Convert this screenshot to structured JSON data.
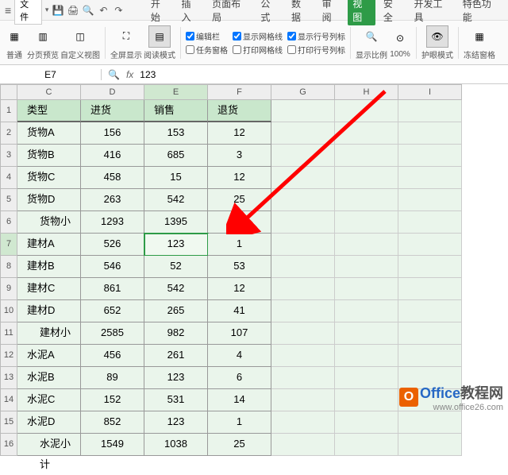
{
  "menubar": {
    "file_label": "文件",
    "tabs": [
      "开始",
      "插入",
      "页面布局",
      "公式",
      "数据",
      "审阅",
      "视图",
      "安全",
      "开发工具",
      "特色功能"
    ],
    "active_tab_index": 6
  },
  "ribbon": {
    "view_normal": "普通",
    "view_pagebreak": "分页预览",
    "view_custom": "自定义视图",
    "view_fullscreen": "全屏显示",
    "view_readmode": "阅读模式",
    "chk_formula_bar": "编辑栏",
    "chk_taskpane": "任务窗格",
    "chk_gridlines": "显示网格线",
    "chk_print_gridlines": "打印网格线",
    "chk_rowcol_hdr": "显示行号列标",
    "chk_print_rowcol": "打印行号列标",
    "zoom_ratio": "显示比例",
    "zoom_100": "100%",
    "eye_mode": "护眼模式",
    "freeze": "冻结窗格"
  },
  "formula_bar": {
    "name_box": "E7",
    "formula": "123"
  },
  "columns": [
    "C",
    "D",
    "E",
    "F",
    "G",
    "H",
    "I"
  ],
  "active_col_index": 2,
  "active_row_index": 7,
  "chart_data": {
    "type": "table",
    "headers": [
      "类型",
      "进货",
      "销售",
      "退货"
    ],
    "rows": [
      {
        "r": 1,
        "label": "类型",
        "vals": [
          "进货",
          "销售",
          "退货"
        ],
        "is_header": true
      },
      {
        "r": 2,
        "label": "货物A",
        "vals": [
          156,
          153,
          12
        ]
      },
      {
        "r": 3,
        "label": "货物B",
        "vals": [
          416,
          685,
          3
        ]
      },
      {
        "r": 4,
        "label": "货物C",
        "vals": [
          458,
          15,
          12
        ]
      },
      {
        "r": 5,
        "label": "货物D",
        "vals": [
          263,
          542,
          25
        ]
      },
      {
        "r": 6,
        "label": "货物小计",
        "vals": [
          1293,
          1395,
          52
        ],
        "subtotal": true
      },
      {
        "r": 7,
        "label": "建材A",
        "vals": [
          526,
          123,
          1
        ]
      },
      {
        "r": 8,
        "label": "建材B",
        "vals": [
          546,
          52,
          53
        ]
      },
      {
        "r": 9,
        "label": "建材C",
        "vals": [
          861,
          542,
          12
        ]
      },
      {
        "r": 10,
        "label": "建材D",
        "vals": [
          652,
          265,
          41
        ]
      },
      {
        "r": 11,
        "label": "建材小计",
        "vals": [
          2585,
          982,
          107
        ],
        "subtotal": true
      },
      {
        "r": 12,
        "label": "水泥A",
        "vals": [
          456,
          261,
          4
        ]
      },
      {
        "r": 13,
        "label": "水泥B",
        "vals": [
          89,
          123,
          6
        ]
      },
      {
        "r": 14,
        "label": "水泥C",
        "vals": [
          152,
          531,
          14
        ]
      },
      {
        "r": 15,
        "label": "水泥D",
        "vals": [
          852,
          123,
          1
        ]
      },
      {
        "r": 16,
        "label": "水泥小计",
        "vals": [
          1549,
          1038,
          25
        ],
        "subtotal": true
      }
    ]
  },
  "watermark": {
    "brand": "Office",
    "suffix": "教程网",
    "url": "www.office26.com"
  }
}
